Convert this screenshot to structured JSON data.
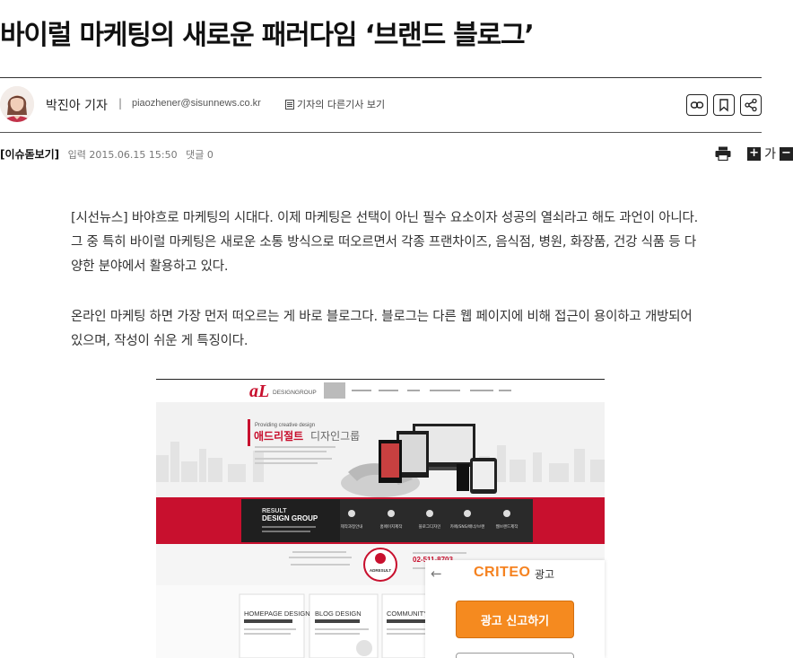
{
  "article": {
    "title": "바이럴 마케팅의 새로운 패러다임 ‘브랜드 블로그’",
    "reporter": "박진아 기자",
    "separator": "|",
    "email": "piaozhener@sisunnews.co.kr",
    "more_articles": "기자의 다른기사 보기",
    "tag": "[이슈돋보기]",
    "date": "입력 2015.06.15 15:50",
    "comments": "댓글 0",
    "font_size_label": "가",
    "font_plus": "+",
    "font_minus": "−",
    "paragraphs": [
      "[시선뉴스] 바야흐로 마케팅의 시대다. 이제 마케팅은 선택이 아닌 필수 요소이자 성공의 열쇠라고 해도 과언이 아니다. 그 중 특히 바이럴 마케팅은 새로운 소통 방식으로 떠오르면서 각종 프랜차이즈, 음식점, 병원, 화장품, 건강 식품 등 다양한 분야에서 활용하고 있다.",
      "온라인 마케팅 하면 가장 먼저 떠오르는 게 바로 블로그다. 블로그는 다른 웹 페이지에 비해 접근이 용이하고 개방되어 있으며, 작성이 쉬운 게 특징이다."
    ]
  },
  "share_tools": [
    {
      "icon": "link-icon"
    },
    {
      "icon": "bookmark-icon"
    },
    {
      "icon": "share-icon"
    }
  ],
  "image": {
    "logo_text": "DESIGNGROUP",
    "hero_small": "Providing creative design",
    "hero_title_red": "애드리절트",
    "hero_title_gray": "디자인그룹",
    "band_brand_1": "RESULT",
    "band_brand_2": "DESIGN GROUP",
    "band_icons": [
      "제작과정안내",
      "홈페이지제작",
      "블로그디자인",
      "카페/SNS/배너/브랜",
      "웹브랜드제작"
    ],
    "phone": "02-511-8703",
    "seal_text": "ADRESULT",
    "cards": [
      "HOMEPAGE DESIGN",
      "BLOG DESIGN",
      "COMMUNITY D"
    ]
  },
  "ad": {
    "brand": "CRITEO",
    "label": "광고",
    "report_button": "광고 신고하기",
    "back_glyph": "←"
  },
  "colors": {
    "accent_red": "#c8102e",
    "ad_orange": "#f58a1f"
  }
}
